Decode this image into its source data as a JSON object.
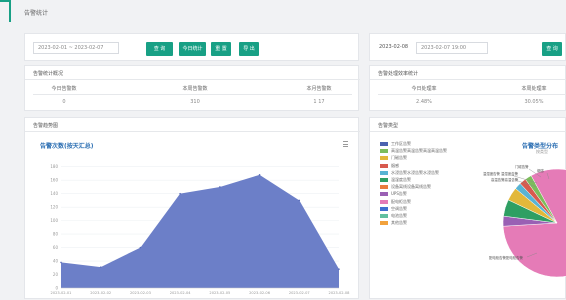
{
  "page": {
    "title": "告警统计"
  },
  "filter_left": {
    "date_value": "2023-02-01 ~ 2023-02-07",
    "buttons": [
      "查 询",
      "今日统计",
      "重 置",
      "导 出"
    ]
  },
  "filter_right": {
    "date_label": "2023-02-08",
    "date_value": "2023-02-07 19:00",
    "button": "查 询"
  },
  "stats_left": {
    "title": "告警统计概况",
    "items": [
      {
        "label": "今日告警数",
        "value": "0"
      },
      {
        "label": "本周告警数",
        "value": "310"
      },
      {
        "label": "本月告警数",
        "value": "1 17"
      }
    ]
  },
  "stats_right": {
    "title": "告警处理效率统计",
    "items": [
      {
        "label": "今日处理率",
        "value": "2.48%"
      },
      {
        "label": "本周处理率",
        "value": "30.05%"
      }
    ]
  },
  "trend_panel": {
    "header": "告警趋势图",
    "chart_title": "告警次数(按天汇总)",
    "menu_icon": "menu-icon"
  },
  "chart_data": {
    "type": "area",
    "title": "告警次数(按天汇总)",
    "categories": [
      "2023-02-01",
      "2023-02-02",
      "2023-02-03",
      "2023-02-04",
      "2023-02-05",
      "2023-02-06",
      "2023-02-07",
      "2023-02-08"
    ],
    "x": [
      "2023-02-01",
      "2023-02-02",
      "2023-02-03",
      "2023-02-04",
      "2023-02-05",
      "2023-02-06",
      "2023-02-07",
      "2023-02-08"
    ],
    "values": [
      38,
      31,
      60,
      140,
      150,
      168,
      130,
      28
    ],
    "yticks": [
      "0",
      "20",
      "40",
      "60",
      "80",
      "100",
      "120",
      "140",
      "160",
      "180"
    ],
    "ylim": [
      0,
      190
    ],
    "color": "#6c7fc8"
  },
  "type_panel": {
    "header": "告警类型",
    "pie_title": "告警类型分布",
    "pie_subtitle": "按类型",
    "legend": [
      {
        "name": "工作区告警",
        "color": "#4b62b0"
      },
      {
        "name": "高温告警高温告警高温高温告警",
        "color": "#7cbd5c"
      },
      {
        "name": "门磁告警",
        "color": "#e2b83a"
      },
      {
        "name": "烟感",
        "color": "#d85a4e"
      },
      {
        "name": "水浸告警水浸告警水浸告警",
        "color": "#58b4d3"
      },
      {
        "name": "温湿度告警",
        "color": "#2e9f63"
      },
      {
        "name": "设备离线设备离线告警",
        "color": "#ea7d3e"
      },
      {
        "name": "UPS告警",
        "color": "#9a60b4"
      },
      {
        "name": "配电柜告警",
        "color": "#e57bb7"
      },
      {
        "name": "空调告警",
        "color": "#3f6fcf"
      },
      {
        "name": "电池告警",
        "color": "#60c0a0"
      },
      {
        "name": "其他告警",
        "color": "#f2a23c"
      }
    ],
    "pie_slices": [
      {
        "name": "配电柜告警",
        "value": 82,
        "color": "#e57bb7"
      },
      {
        "name": "UPS告警",
        "value": 3,
        "color": "#9a60b4"
      },
      {
        "name": "温湿度告警",
        "value": 5,
        "color": "#2e9f63"
      },
      {
        "name": "门磁告警",
        "value": 4,
        "color": "#e2b83a"
      },
      {
        "name": "水浸告警水浸告警水浸告警",
        "value": 2,
        "color": "#58b4d3"
      },
      {
        "name": "烟感",
        "value": 2,
        "color": "#d85a4e"
      },
      {
        "name": "高温告警高温告警高温高温告警",
        "value": 2,
        "color": "#7cbd5c"
      }
    ],
    "pie_labels": [
      "门磁告警",
      "烟感",
      "温湿度告警 温湿度告警",
      "高温告警高温告警",
      "配电柜告警配电柜告警"
    ]
  }
}
